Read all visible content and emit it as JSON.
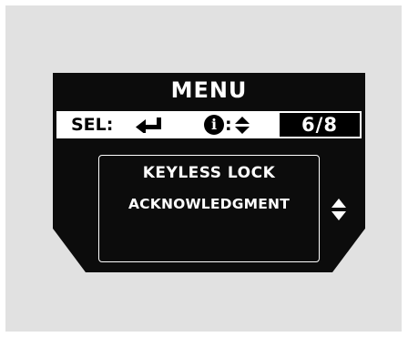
{
  "screen": {
    "title": "MENU",
    "status_bar": {
      "select_label": "SEL:",
      "info_label": "i",
      "info_separator": ":",
      "page_indicator": "6/8"
    },
    "content": {
      "line1": "KEYLESS LOCK",
      "line2": "ACKNOWLEDGMENT"
    },
    "icons": [
      "enter-arrow-icon",
      "info-icon",
      "up-down-arrows-icon"
    ]
  }
}
